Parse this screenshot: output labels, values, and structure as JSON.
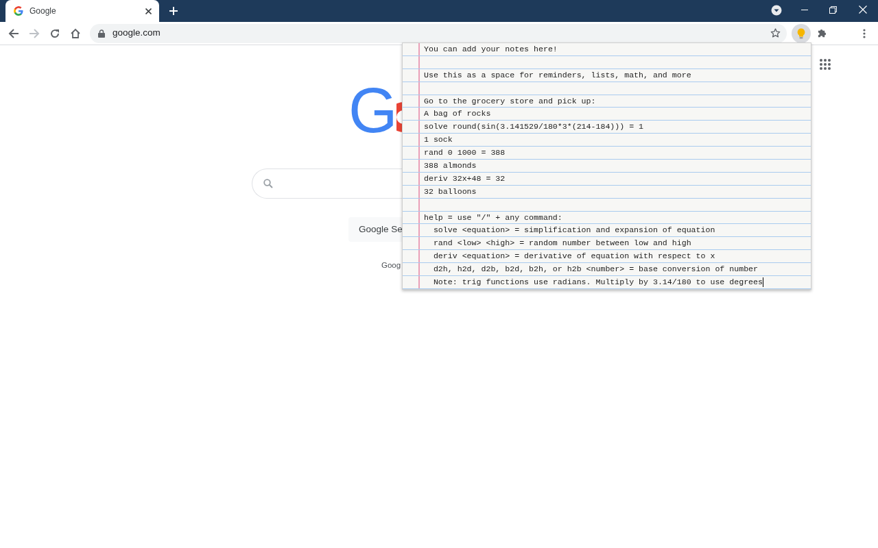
{
  "window": {
    "tabs": [
      {
        "title": "Google",
        "selected": true
      }
    ]
  },
  "toolbar": {
    "url": "google.com",
    "extensions": [
      {
        "kind": "bulb",
        "active": true
      },
      {
        "kind": "puzzle",
        "active": false
      }
    ]
  },
  "page": {
    "logo_text": "G",
    "search_button": "Google Se",
    "language_text": "Goog"
  },
  "notes": {
    "cursor_at_end": true,
    "lines": [
      {
        "kind": "text",
        "text": "You can add your notes here!"
      },
      {
        "kind": "blank"
      },
      {
        "kind": "text",
        "text": "Use this as a space for reminders, lists, math, and more"
      },
      {
        "kind": "blank"
      },
      {
        "kind": "text",
        "text": "Go to the grocery store and pick up:"
      },
      {
        "kind": "text",
        "text": "A bag of rocks"
      },
      {
        "kind": "text",
        "text": "solve round(sin(3.141529/180*3*(214-184))) = 1"
      },
      {
        "kind": "text",
        "text": "1 sock"
      },
      {
        "kind": "text",
        "text": "rand 0 1000 = 388"
      },
      {
        "kind": "text",
        "text": "388 almonds"
      },
      {
        "kind": "text",
        "text": "deriv 32x+48 = 32"
      },
      {
        "kind": "text",
        "text": "32 balloons"
      },
      {
        "kind": "blank"
      },
      {
        "kind": "text",
        "text": "help = use \"/\" + any command:"
      },
      {
        "kind": "text",
        "text": "  solve <equation> = simplification and expansion of equation"
      },
      {
        "kind": "text",
        "text": "  rand <low> <high> = random number between low and high"
      },
      {
        "kind": "text",
        "text": "  deriv <equation> = derivative of equation with respect to x"
      },
      {
        "kind": "text",
        "text": "  d2h, h2d, d2b, b2d, b2h, or h2b <number> = base conversion of number"
      },
      {
        "kind": "text",
        "text": "  Note: trig functions use radians. Multiply by 3.14/180 to use degrees"
      }
    ]
  }
}
